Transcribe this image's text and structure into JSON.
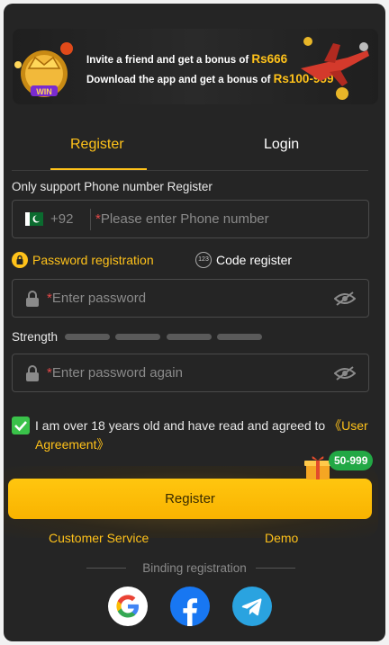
{
  "banner": {
    "line1_text": "Invite a friend and get a bonus of",
    "line1_amount": "Rs666",
    "line2_text": "Download the app and get a bonus of",
    "line2_amount": "Rs100-999",
    "logo_text": "WIN"
  },
  "tabs": [
    {
      "label": "Register",
      "active": true
    },
    {
      "label": "Login",
      "active": false
    }
  ],
  "phone": {
    "section_label": "Only support Phone number Register",
    "country_code": "+92",
    "required_mark": "*",
    "placeholder": "Please enter Phone number"
  },
  "reg_options": {
    "password_label": "Password registration",
    "code_label": "Code register",
    "code_icon_text": "123"
  },
  "password": {
    "required_mark": "*",
    "placeholder": "Enter password"
  },
  "strength": {
    "label": "Strength"
  },
  "password_again": {
    "required_mark": "*",
    "placeholder": "Enter password again"
  },
  "agreement": {
    "text": "I am over 18 years old and have read and agreed to ",
    "link": "《User Agreement》",
    "checked": true
  },
  "register_button": {
    "label": "Register",
    "bonus_badge": "50-999"
  },
  "footer": {
    "customer_service": "Customer Service",
    "demo": "Demo",
    "binding_label": "Binding registration"
  },
  "social": [
    "google-icon",
    "facebook-icon",
    "telegram-icon"
  ],
  "colors": {
    "background": "#252525",
    "accent": "#ffc21a",
    "required": "#e54848",
    "check": "#3ac24a"
  }
}
